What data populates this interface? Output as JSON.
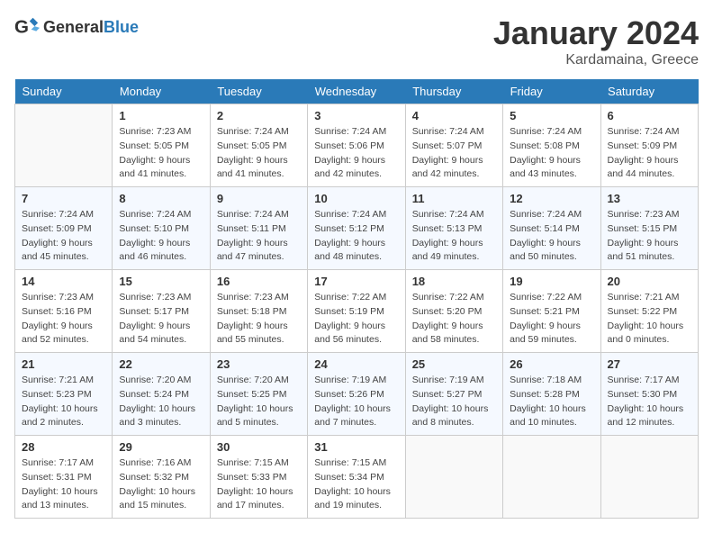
{
  "logo": {
    "general": "General",
    "blue": "Blue"
  },
  "header": {
    "month": "January 2024",
    "location": "Kardamaina, Greece"
  },
  "weekdays": [
    "Sunday",
    "Monday",
    "Tuesday",
    "Wednesday",
    "Thursday",
    "Friday",
    "Saturday"
  ],
  "weeks": [
    [
      null,
      {
        "day": 1,
        "sunrise": "7:23 AM",
        "sunset": "5:05 PM",
        "daylight": "9 hours and 41 minutes."
      },
      {
        "day": 2,
        "sunrise": "7:24 AM",
        "sunset": "5:05 PM",
        "daylight": "9 hours and 41 minutes."
      },
      {
        "day": 3,
        "sunrise": "7:24 AM",
        "sunset": "5:06 PM",
        "daylight": "9 hours and 42 minutes."
      },
      {
        "day": 4,
        "sunrise": "7:24 AM",
        "sunset": "5:07 PM",
        "daylight": "9 hours and 42 minutes."
      },
      {
        "day": 5,
        "sunrise": "7:24 AM",
        "sunset": "5:08 PM",
        "daylight": "9 hours and 43 minutes."
      },
      {
        "day": 6,
        "sunrise": "7:24 AM",
        "sunset": "5:09 PM",
        "daylight": "9 hours and 44 minutes."
      }
    ],
    [
      {
        "day": 7,
        "sunrise": "7:24 AM",
        "sunset": "5:09 PM",
        "daylight": "9 hours and 45 minutes."
      },
      {
        "day": 8,
        "sunrise": "7:24 AM",
        "sunset": "5:10 PM",
        "daylight": "9 hours and 46 minutes."
      },
      {
        "day": 9,
        "sunrise": "7:24 AM",
        "sunset": "5:11 PM",
        "daylight": "9 hours and 47 minutes."
      },
      {
        "day": 10,
        "sunrise": "7:24 AM",
        "sunset": "5:12 PM",
        "daylight": "9 hours and 48 minutes."
      },
      {
        "day": 11,
        "sunrise": "7:24 AM",
        "sunset": "5:13 PM",
        "daylight": "9 hours and 49 minutes."
      },
      {
        "day": 12,
        "sunrise": "7:24 AM",
        "sunset": "5:14 PM",
        "daylight": "9 hours and 50 minutes."
      },
      {
        "day": 13,
        "sunrise": "7:23 AM",
        "sunset": "5:15 PM",
        "daylight": "9 hours and 51 minutes."
      }
    ],
    [
      {
        "day": 14,
        "sunrise": "7:23 AM",
        "sunset": "5:16 PM",
        "daylight": "9 hours and 52 minutes."
      },
      {
        "day": 15,
        "sunrise": "7:23 AM",
        "sunset": "5:17 PM",
        "daylight": "9 hours and 54 minutes."
      },
      {
        "day": 16,
        "sunrise": "7:23 AM",
        "sunset": "5:18 PM",
        "daylight": "9 hours and 55 minutes."
      },
      {
        "day": 17,
        "sunrise": "7:22 AM",
        "sunset": "5:19 PM",
        "daylight": "9 hours and 56 minutes."
      },
      {
        "day": 18,
        "sunrise": "7:22 AM",
        "sunset": "5:20 PM",
        "daylight": "9 hours and 58 minutes."
      },
      {
        "day": 19,
        "sunrise": "7:22 AM",
        "sunset": "5:21 PM",
        "daylight": "9 hours and 59 minutes."
      },
      {
        "day": 20,
        "sunrise": "7:21 AM",
        "sunset": "5:22 PM",
        "daylight": "10 hours and 0 minutes."
      }
    ],
    [
      {
        "day": 21,
        "sunrise": "7:21 AM",
        "sunset": "5:23 PM",
        "daylight": "10 hours and 2 minutes."
      },
      {
        "day": 22,
        "sunrise": "7:20 AM",
        "sunset": "5:24 PM",
        "daylight": "10 hours and 3 minutes."
      },
      {
        "day": 23,
        "sunrise": "7:20 AM",
        "sunset": "5:25 PM",
        "daylight": "10 hours and 5 minutes."
      },
      {
        "day": 24,
        "sunrise": "7:19 AM",
        "sunset": "5:26 PM",
        "daylight": "10 hours and 7 minutes."
      },
      {
        "day": 25,
        "sunrise": "7:19 AM",
        "sunset": "5:27 PM",
        "daylight": "10 hours and 8 minutes."
      },
      {
        "day": 26,
        "sunrise": "7:18 AM",
        "sunset": "5:28 PM",
        "daylight": "10 hours and 10 minutes."
      },
      {
        "day": 27,
        "sunrise": "7:17 AM",
        "sunset": "5:30 PM",
        "daylight": "10 hours and 12 minutes."
      }
    ],
    [
      {
        "day": 28,
        "sunrise": "7:17 AM",
        "sunset": "5:31 PM",
        "daylight": "10 hours and 13 minutes."
      },
      {
        "day": 29,
        "sunrise": "7:16 AM",
        "sunset": "5:32 PM",
        "daylight": "10 hours and 15 minutes."
      },
      {
        "day": 30,
        "sunrise": "7:15 AM",
        "sunset": "5:33 PM",
        "daylight": "10 hours and 17 minutes."
      },
      {
        "day": 31,
        "sunrise": "7:15 AM",
        "sunset": "5:34 PM",
        "daylight": "10 hours and 19 minutes."
      },
      null,
      null,
      null
    ]
  ],
  "labels": {
    "sunrise_prefix": "Sunrise: ",
    "sunset_prefix": "Sunset: ",
    "daylight_prefix": "Daylight: "
  }
}
